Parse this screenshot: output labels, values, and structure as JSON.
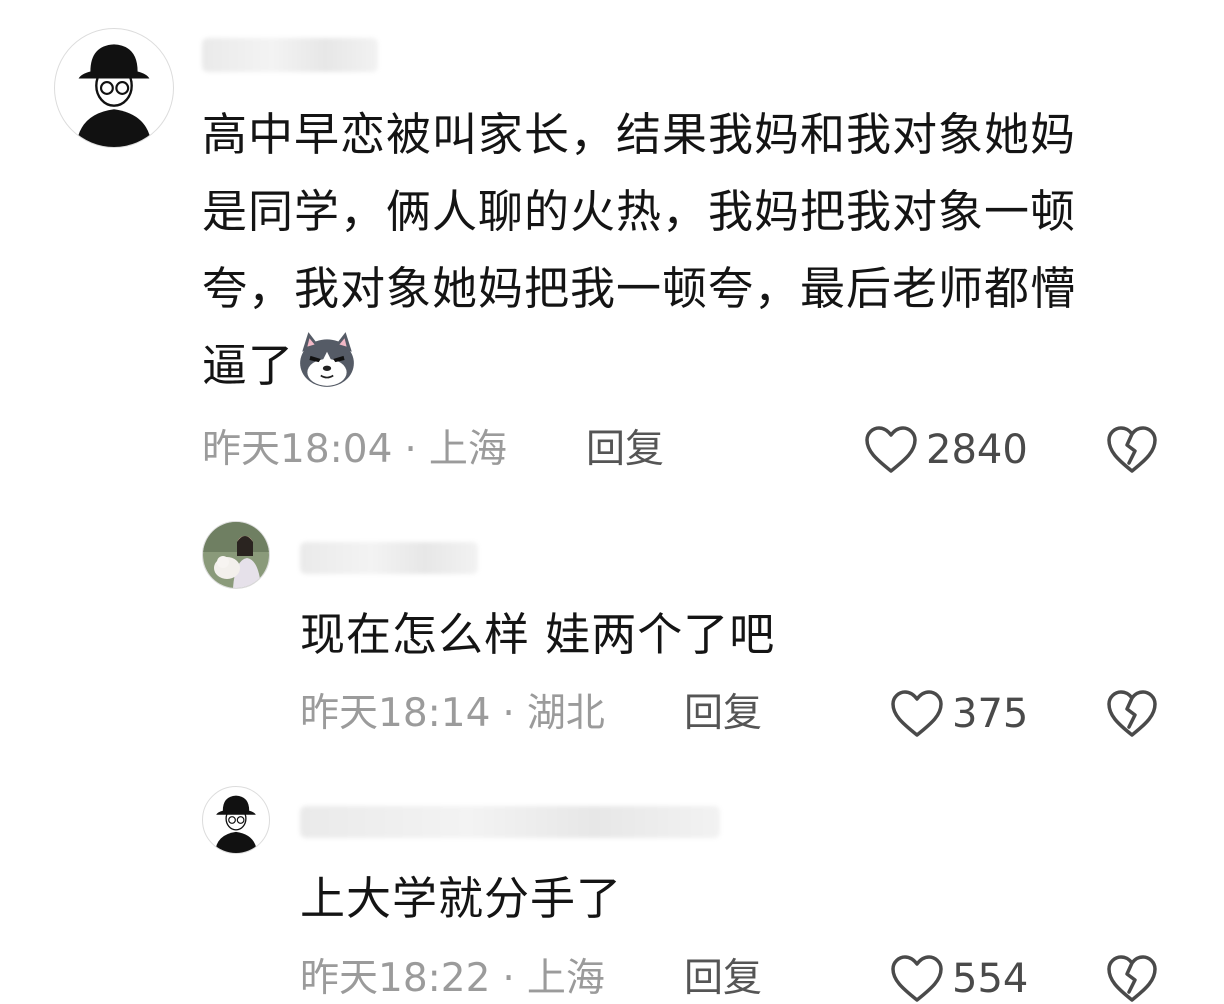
{
  "comments": [
    {
      "text": "高中早恋被叫家长，结果我妈和我对象她妈\n是同学，俩人聊的火热，我妈把我对象一顿\n夸，我对象她妈把我一顿夸，最后老师都懵\n逼了",
      "emoji": "husky-dog-emoji",
      "time": "昨天18:04",
      "separator": "·",
      "location": "上海",
      "reply_label": "回复",
      "likes": "2840"
    },
    {
      "text": "现在怎么样 娃两个了吧",
      "time": "昨天18:14",
      "separator": "·",
      "location": "湖北",
      "reply_label": "回复",
      "likes": "375"
    },
    {
      "text": "上大学就分手了",
      "time": "昨天18:22",
      "separator": "·",
      "location": "上海",
      "reply_label": "回复",
      "likes": "554"
    }
  ],
  "icons": {
    "like": "heart-outline-icon",
    "dislike": "broken-heart-icon"
  },
  "colors": {
    "text": "#141414",
    "meta": "#9b9b9b",
    "reply": "#555555",
    "icon": "#4a4a4a"
  }
}
